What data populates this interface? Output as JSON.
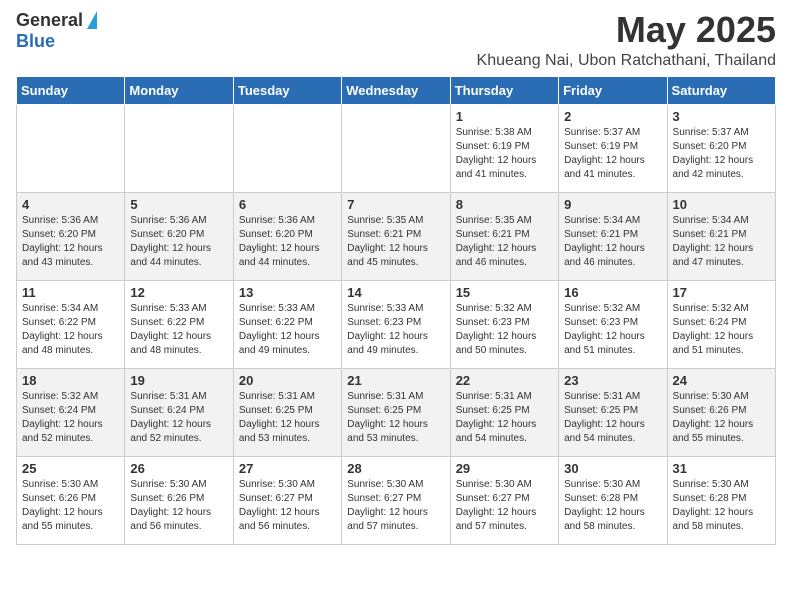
{
  "logo": {
    "general": "General",
    "blue": "Blue"
  },
  "title": {
    "month": "May 2025",
    "location": "Khueang Nai, Ubon Ratchathani, Thailand"
  },
  "weekdays": [
    "Sunday",
    "Monday",
    "Tuesday",
    "Wednesday",
    "Thursday",
    "Friday",
    "Saturday"
  ],
  "weeks": [
    [
      {
        "day": "",
        "info": ""
      },
      {
        "day": "",
        "info": ""
      },
      {
        "day": "",
        "info": ""
      },
      {
        "day": "",
        "info": ""
      },
      {
        "day": "1",
        "info": "Sunrise: 5:38 AM\nSunset: 6:19 PM\nDaylight: 12 hours\nand 41 minutes."
      },
      {
        "day": "2",
        "info": "Sunrise: 5:37 AM\nSunset: 6:19 PM\nDaylight: 12 hours\nand 41 minutes."
      },
      {
        "day": "3",
        "info": "Sunrise: 5:37 AM\nSunset: 6:20 PM\nDaylight: 12 hours\nand 42 minutes."
      }
    ],
    [
      {
        "day": "4",
        "info": "Sunrise: 5:36 AM\nSunset: 6:20 PM\nDaylight: 12 hours\nand 43 minutes."
      },
      {
        "day": "5",
        "info": "Sunrise: 5:36 AM\nSunset: 6:20 PM\nDaylight: 12 hours\nand 44 minutes."
      },
      {
        "day": "6",
        "info": "Sunrise: 5:36 AM\nSunset: 6:20 PM\nDaylight: 12 hours\nand 44 minutes."
      },
      {
        "day": "7",
        "info": "Sunrise: 5:35 AM\nSunset: 6:21 PM\nDaylight: 12 hours\nand 45 minutes."
      },
      {
        "day": "8",
        "info": "Sunrise: 5:35 AM\nSunset: 6:21 PM\nDaylight: 12 hours\nand 46 minutes."
      },
      {
        "day": "9",
        "info": "Sunrise: 5:34 AM\nSunset: 6:21 PM\nDaylight: 12 hours\nand 46 minutes."
      },
      {
        "day": "10",
        "info": "Sunrise: 5:34 AM\nSunset: 6:21 PM\nDaylight: 12 hours\nand 47 minutes."
      }
    ],
    [
      {
        "day": "11",
        "info": "Sunrise: 5:34 AM\nSunset: 6:22 PM\nDaylight: 12 hours\nand 48 minutes."
      },
      {
        "day": "12",
        "info": "Sunrise: 5:33 AM\nSunset: 6:22 PM\nDaylight: 12 hours\nand 48 minutes."
      },
      {
        "day": "13",
        "info": "Sunrise: 5:33 AM\nSunset: 6:22 PM\nDaylight: 12 hours\nand 49 minutes."
      },
      {
        "day": "14",
        "info": "Sunrise: 5:33 AM\nSunset: 6:23 PM\nDaylight: 12 hours\nand 49 minutes."
      },
      {
        "day": "15",
        "info": "Sunrise: 5:32 AM\nSunset: 6:23 PM\nDaylight: 12 hours\nand 50 minutes."
      },
      {
        "day": "16",
        "info": "Sunrise: 5:32 AM\nSunset: 6:23 PM\nDaylight: 12 hours\nand 51 minutes."
      },
      {
        "day": "17",
        "info": "Sunrise: 5:32 AM\nSunset: 6:24 PM\nDaylight: 12 hours\nand 51 minutes."
      }
    ],
    [
      {
        "day": "18",
        "info": "Sunrise: 5:32 AM\nSunset: 6:24 PM\nDaylight: 12 hours\nand 52 minutes."
      },
      {
        "day": "19",
        "info": "Sunrise: 5:31 AM\nSunset: 6:24 PM\nDaylight: 12 hours\nand 52 minutes."
      },
      {
        "day": "20",
        "info": "Sunrise: 5:31 AM\nSunset: 6:25 PM\nDaylight: 12 hours\nand 53 minutes."
      },
      {
        "day": "21",
        "info": "Sunrise: 5:31 AM\nSunset: 6:25 PM\nDaylight: 12 hours\nand 53 minutes."
      },
      {
        "day": "22",
        "info": "Sunrise: 5:31 AM\nSunset: 6:25 PM\nDaylight: 12 hours\nand 54 minutes."
      },
      {
        "day": "23",
        "info": "Sunrise: 5:31 AM\nSunset: 6:25 PM\nDaylight: 12 hours\nand 54 minutes."
      },
      {
        "day": "24",
        "info": "Sunrise: 5:30 AM\nSunset: 6:26 PM\nDaylight: 12 hours\nand 55 minutes."
      }
    ],
    [
      {
        "day": "25",
        "info": "Sunrise: 5:30 AM\nSunset: 6:26 PM\nDaylight: 12 hours\nand 55 minutes."
      },
      {
        "day": "26",
        "info": "Sunrise: 5:30 AM\nSunset: 6:26 PM\nDaylight: 12 hours\nand 56 minutes."
      },
      {
        "day": "27",
        "info": "Sunrise: 5:30 AM\nSunset: 6:27 PM\nDaylight: 12 hours\nand 56 minutes."
      },
      {
        "day": "28",
        "info": "Sunrise: 5:30 AM\nSunset: 6:27 PM\nDaylight: 12 hours\nand 57 minutes."
      },
      {
        "day": "29",
        "info": "Sunrise: 5:30 AM\nSunset: 6:27 PM\nDaylight: 12 hours\nand 57 minutes."
      },
      {
        "day": "30",
        "info": "Sunrise: 5:30 AM\nSunset: 6:28 PM\nDaylight: 12 hours\nand 58 minutes."
      },
      {
        "day": "31",
        "info": "Sunrise: 5:30 AM\nSunset: 6:28 PM\nDaylight: 12 hours\nand 58 minutes."
      }
    ]
  ]
}
